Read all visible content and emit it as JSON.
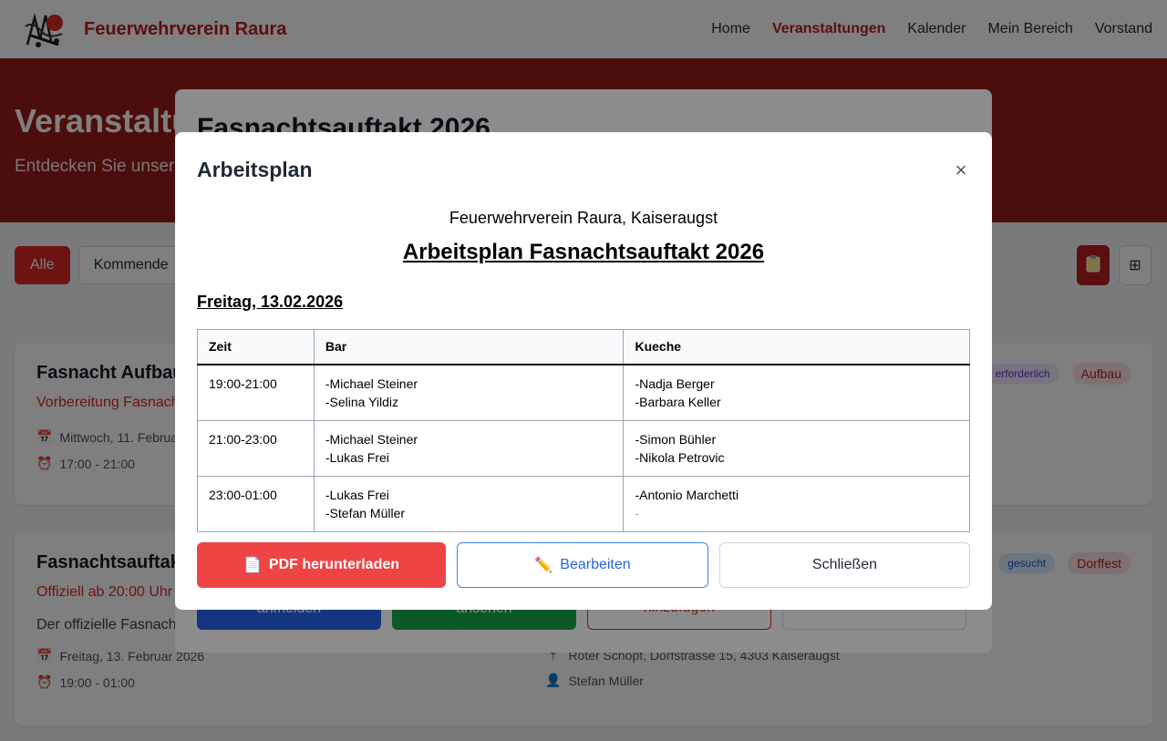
{
  "brand": {
    "name": "Feuerwehrverein Raura"
  },
  "nav": {
    "home": "Home",
    "events": "Veranstaltungen",
    "calendar": "Kalender",
    "my_area": "Mein Bereich",
    "board": "Vorstand"
  },
  "hero": {
    "title": "Veranstaltu",
    "subtitle": "Entdecken Sie unser"
  },
  "filters": {
    "all": "Alle",
    "upcoming": "Kommende"
  },
  "view_icons": {
    "list": "clipboard-icon",
    "grid": "grid-icon"
  },
  "cards": [
    {
      "title": "Fasnacht Aufbau",
      "subtitle": "Vorbereitung Fasnach",
      "date": "Mittwoch, 11. Februa",
      "time": "17:00 - 21:00",
      "badge_status": "erforderlich",
      "badge_category": "Aufbau"
    },
    {
      "title": "Fasnachtsauftakt",
      "subtitle": "Offiziell ab 20:00 Uhr",
      "description": "Der offizielle Fasnach",
      "date": "Freitag, 13. Februar 2026",
      "time": "19:00 - 01:00",
      "location": "Roter Schopf, Dorfstrasse 15, 4303 Kaiseraugst",
      "organizer": "Stefan Müller",
      "badge_status": "gesucht",
      "badge_category": "Dorffest"
    }
  ],
  "back_modal": {
    "title": "Fasnachtsauftakt 2026",
    "btn_register": "anmelden",
    "btn_view": "ansehen",
    "btn_add": "hinzufügen"
  },
  "modal": {
    "title": "Arbeitsplan",
    "close": "×",
    "org": "Feuerwehrverein Raura, Kaiseraugst",
    "plan_title": "Arbeitsplan Fasnachtsauftakt 2026",
    "day": "Freitag, 13.02.2026",
    "columns": [
      "Zeit",
      "Bar",
      "Kueche"
    ],
    "rows": [
      {
        "time": "19:00-21:00",
        "bar": [
          "-Michael Steiner",
          "-Selina Yildiz"
        ],
        "kitchen": [
          "-Nadja Berger",
          "-Barbara Keller"
        ]
      },
      {
        "time": "21:00-23:00",
        "bar": [
          "-Michael Steiner",
          "-Lukas Frei"
        ],
        "kitchen": [
          "-Simon Bühler",
          "-Nikola Petrovic"
        ]
      },
      {
        "time": "23:00-01:00",
        "bar": [
          "-Lukas Frei",
          "-Stefan Müller"
        ],
        "kitchen": [
          "-Antonio Marchetti",
          "-"
        ]
      }
    ],
    "btn_pdf": "PDF herunterladen",
    "btn_edit": "Bearbeiten",
    "btn_close": "Schließen"
  },
  "colors": {
    "brand_red": "#b91c1c",
    "hero_red": "#991b1b",
    "pdf_red": "#ef4444",
    "edit_blue": "#2563eb"
  }
}
